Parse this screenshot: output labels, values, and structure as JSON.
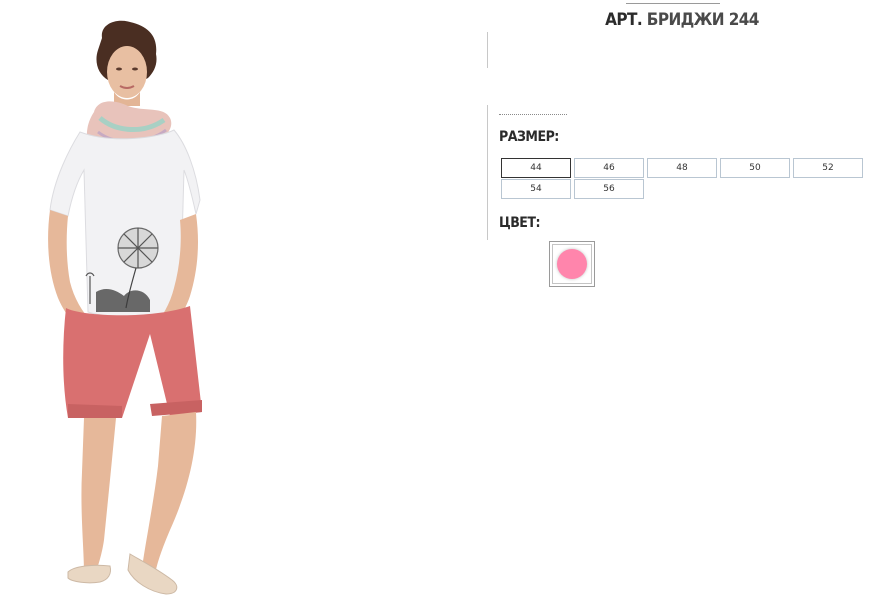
{
  "product": {
    "title_prefix": "АРТ.",
    "title_name": "БРИДЖИ 244",
    "image_alt": "model-photo"
  },
  "size_section": {
    "label": "РАЗМЕР:",
    "sizes": [
      "44",
      "46",
      "48",
      "50",
      "52",
      "54",
      "56"
    ],
    "selected": "44"
  },
  "color_section": {
    "label": "ЦВЕТ:",
    "swatches": [
      {
        "name": "pink",
        "hex": "#ff85ac"
      }
    ]
  },
  "colors": {
    "shorts": "#d97070",
    "top": "#f3f3f4",
    "skin": "#e6b89a",
    "hair": "#4a2e22",
    "scarf": "#e8c3bb",
    "shoes": "#e9d7c3",
    "border": "#b9c6d2"
  }
}
